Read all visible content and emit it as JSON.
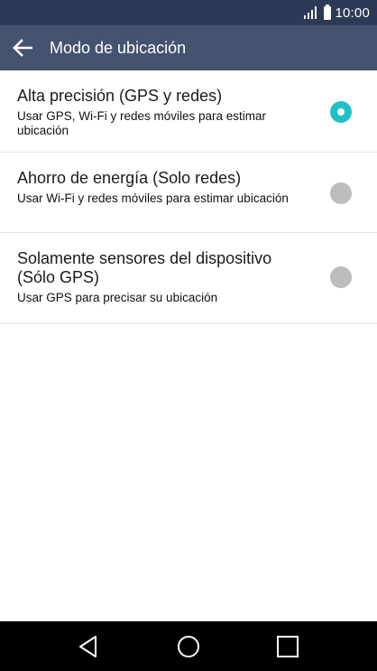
{
  "status_bar": {
    "time": "10:00",
    "icons": [
      "signal-icon",
      "battery-icon"
    ]
  },
  "app_bar": {
    "title": "Modo de ubicación",
    "back_icon": "arrow-back-icon"
  },
  "options": [
    {
      "title": "Alta precisión (GPS y redes)",
      "subtitle": "Usar GPS, Wi-Fi y redes móviles para estimar ubicación",
      "selected": true
    },
    {
      "title": "Ahorro de energía (Solo redes)",
      "subtitle": "Usar Wi-Fi y redes móviles para estimar ubicación",
      "selected": false
    },
    {
      "title": "Solamente sensores del dispositivo (Sólo GPS)",
      "subtitle": "Usar GPS para precisar su ubicación",
      "selected": false
    }
  ],
  "nav_bar": {
    "icons": [
      "back-triangle-icon",
      "home-circle-icon",
      "recents-square-icon"
    ]
  },
  "colors": {
    "status_bar": "#2c3a56",
    "app_bar": "#44546f",
    "accent": "#1fc2c4",
    "radio_off": "#bdbdbd"
  }
}
